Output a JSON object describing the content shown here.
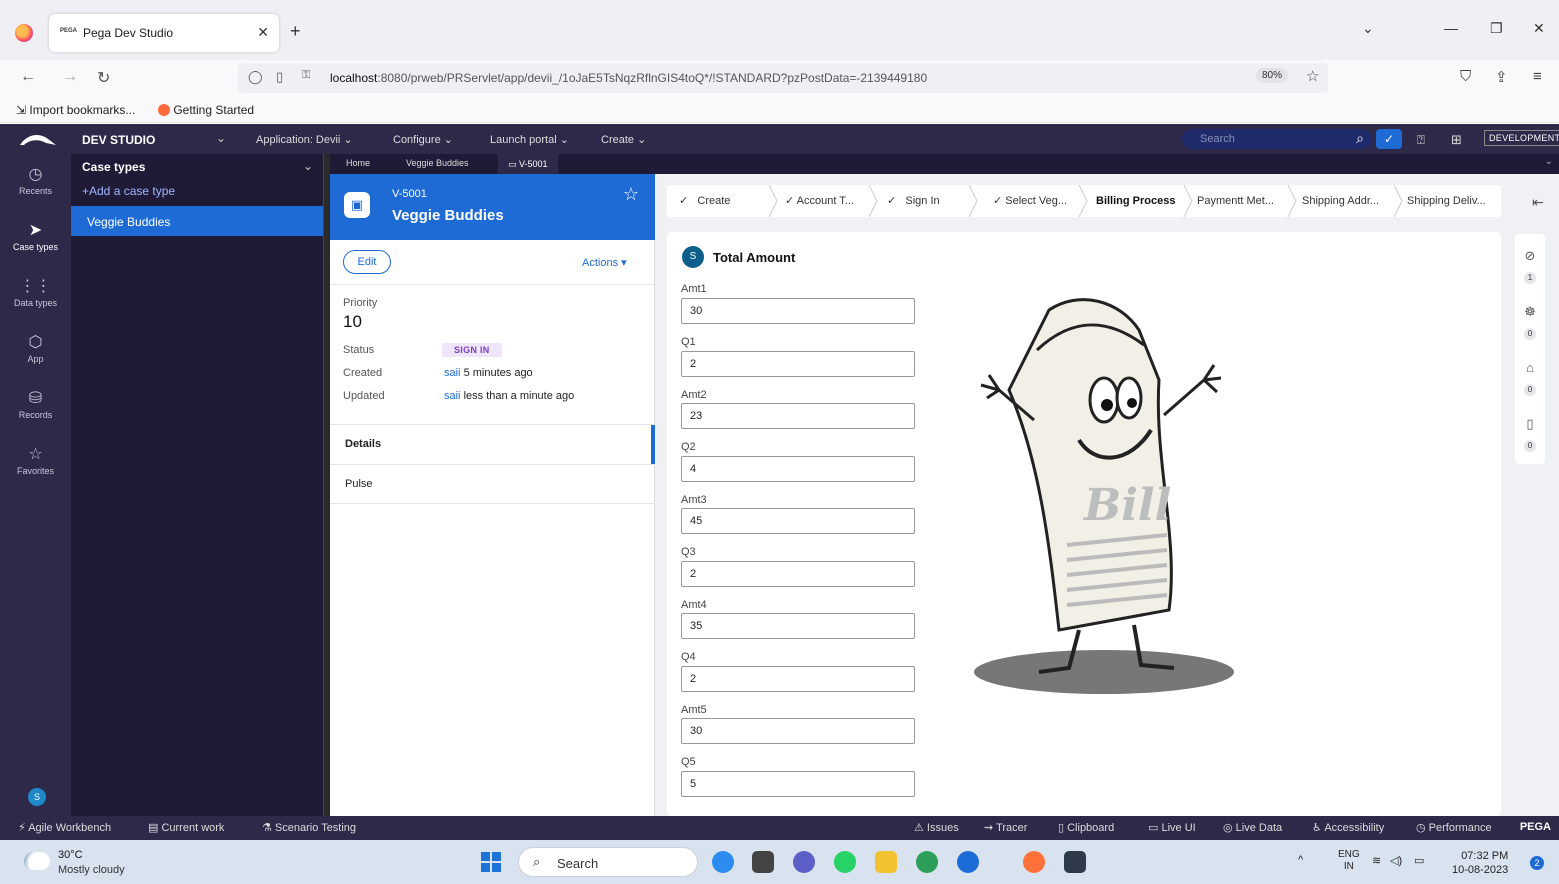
{
  "browser": {
    "tab_favicon": "PEGA",
    "tab_title": "Pega Dev Studio",
    "url_host": "localhost",
    "url_rest": ":8080/prweb/PRServlet/app/devii_/1oJaE5TsNqzRflnGIS4toQ*/!STANDARD?pzPostData=-2139449180",
    "zoom": "80%",
    "bookmarks": [
      "Import bookmarks...",
      "Getting Started"
    ]
  },
  "header": {
    "studio": "DEV STUDIO",
    "application": "Application: Devii",
    "menus": [
      "Configure",
      "Launch portal",
      "Create"
    ],
    "search_placeholder": "Search",
    "env_badge": "DEVELOPMENT"
  },
  "rail": [
    {
      "label": "Recents",
      "icon": "clock-icon"
    },
    {
      "label": "Case types",
      "icon": "case-types-icon"
    },
    {
      "label": "Data types",
      "icon": "grid-icon"
    },
    {
      "label": "App",
      "icon": "cube-icon"
    },
    {
      "label": "Records",
      "icon": "records-icon"
    },
    {
      "label": "Favorites",
      "icon": "star-icon"
    }
  ],
  "rail_avatar": "S",
  "case_types": {
    "title": "Case types",
    "add_label": "+Add a case type",
    "selected": "Veggie Buddies"
  },
  "work_tabs": [
    "Home",
    "Veggie Buddies",
    "V-5001"
  ],
  "summary": {
    "case_id": "V-5001",
    "case_name": "Veggie Buddies",
    "edit": "Edit",
    "actions": "Actions",
    "priority_label": "Priority",
    "priority_value": "10",
    "status_label": "Status",
    "status_value": "SIGN IN",
    "created_label": "Created",
    "created_user": "saii",
    "created_time": "5 minutes ago",
    "updated_label": "Updated",
    "updated_user": "saii",
    "updated_time": "less than a minute ago",
    "tabs": [
      "Details",
      "Pulse"
    ]
  },
  "stages": [
    {
      "label": "Create",
      "done": true
    },
    {
      "label": "Account T...",
      "done": true
    },
    {
      "label": "Sign In",
      "done": true
    },
    {
      "label": "Select Veg...",
      "done": true
    },
    {
      "label": "Billing Process",
      "current": true
    },
    {
      "label": "Paymentt Met..."
    },
    {
      "label": "Shipping Addr..."
    },
    {
      "label": "Shipping Deliv..."
    }
  ],
  "form": {
    "section_badge": "S",
    "section_title": "Total Amount",
    "fields": [
      {
        "label": "Amt1",
        "value": "30"
      },
      {
        "label": "Q1",
        "value": "2"
      },
      {
        "label": "Amt2",
        "value": "23"
      },
      {
        "label": "Q2",
        "value": "4"
      },
      {
        "label": "Amt3",
        "value": "45"
      },
      {
        "label": "Q3",
        "value": "2"
      },
      {
        "label": "Amt4",
        "value": "35"
      },
      {
        "label": "Q4",
        "value": "2"
      },
      {
        "label": "Amt5",
        "value": "30"
      },
      {
        "label": "Q5",
        "value": "5"
      }
    ],
    "image_text": "Bill"
  },
  "util_counts": [
    "1",
    "0",
    "0",
    "0"
  ],
  "devbar": {
    "left": [
      "Agile Workbench",
      "Current work",
      "Scenario Testing"
    ],
    "right": [
      "Issues",
      "Tracer",
      "Clipboard",
      "Live UI",
      "Live Data",
      "Accessibility",
      "Performance"
    ],
    "brand": "PEGA"
  },
  "taskbar": {
    "temp": "30°C",
    "weather": "Mostly cloudy",
    "search": "Search",
    "lang1": "ENG",
    "lang2": "IN",
    "time": "07:32 PM",
    "date": "10-08-2023",
    "notif": "2"
  },
  "colors": {
    "pega_header": "#2e2849",
    "accent_blue": "#1e6bd6",
    "status_purple": "#7a3dbf"
  }
}
